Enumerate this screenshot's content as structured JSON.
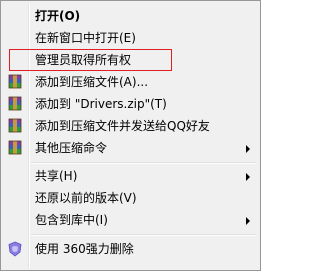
{
  "menu": {
    "items": [
      {
        "label": "打开(O)"
      },
      {
        "label": "在新窗口中打开(E)"
      },
      {
        "label": "管理员取得所有权"
      },
      {
        "label": "添加到压缩文件(A)...",
        "icon": "winrar-archive-icon"
      },
      {
        "label": "添加到 \"Drivers.zip\"(T)",
        "icon": "winrar-archive-icon"
      },
      {
        "label": "添加到压缩文件并发送给QQ好友",
        "icon": "winrar-archive-icon"
      },
      {
        "label": "其他压缩命令",
        "icon": "winrar-archive-icon"
      },
      {
        "label": "共享(H)"
      },
      {
        "label": "还原以前的版本(V)"
      },
      {
        "label": "包含到库中(I)"
      },
      {
        "label": "使用 360强力删除",
        "icon": "360-shield-icon"
      }
    ]
  },
  "colors": {
    "menu_bg": "#f0f0f0",
    "highlight_border": "#e02020",
    "winrar_red": "#c0282a",
    "winrar_blue": "#3b5fbf",
    "winrar_green": "#2e9e3e",
    "purple_360": "#8a7fe0"
  }
}
